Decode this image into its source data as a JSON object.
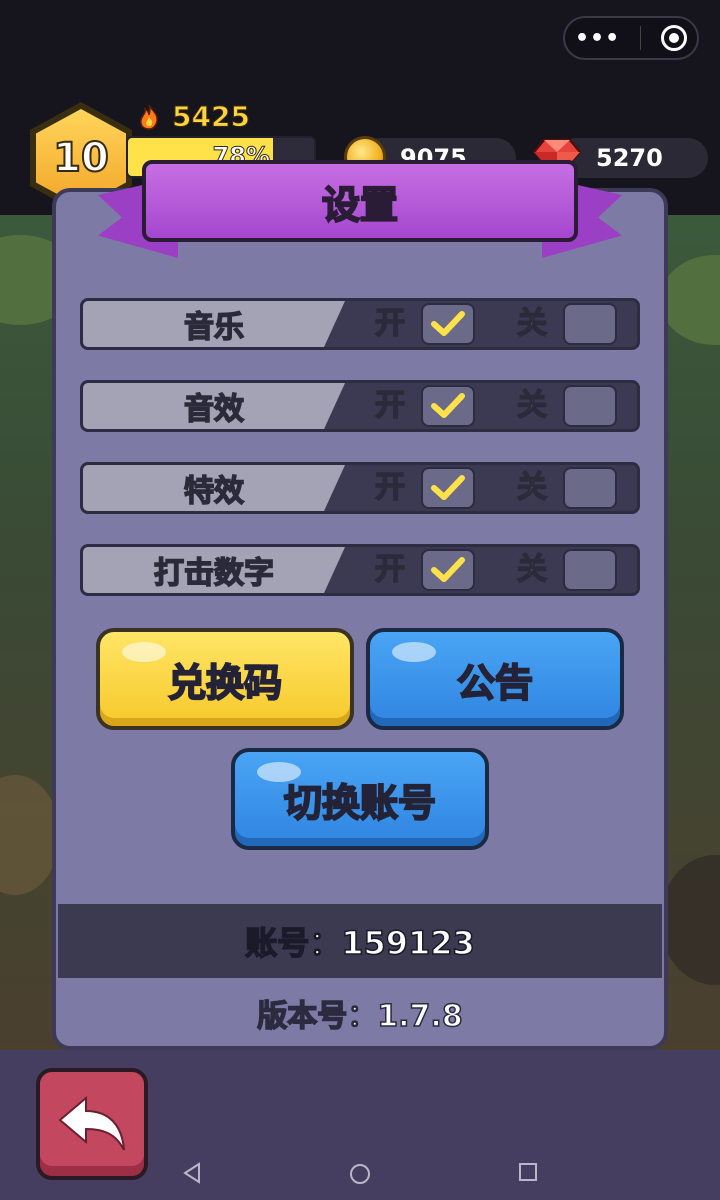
{
  "hud": {
    "level": "10",
    "fire_value": "5425",
    "xp_percent_text": "78%",
    "xp_progress": 0.78,
    "coins": "9075",
    "gems": "5270"
  },
  "dialog": {
    "title": "设置",
    "on_label": "开",
    "off_label": "关",
    "settings": [
      {
        "label": "音乐",
        "on": true
      },
      {
        "label": "音效",
        "on": true
      },
      {
        "label": "特效",
        "on": true
      },
      {
        "label": "打击数字",
        "on": true
      }
    ],
    "buttons": {
      "redeem": "兑换码",
      "notice": "公告",
      "switch_account": "切换账号"
    },
    "account_text": "账号：159123",
    "version_text": "版本号：1.7.8"
  },
  "icons": {
    "menu": "more-dots-icon",
    "close": "target-circle-icon",
    "back": "back-arrow-icon",
    "fire": "fire-icon",
    "coin": "coin-icon",
    "gem": "gem-icon"
  },
  "colors": {
    "panel": "#7d7aa6",
    "ribbon": "#b357d8",
    "yellow_button": "#f7c92a",
    "blue_button": "#2f84e0",
    "back_button": "#c2475f",
    "xp_fill": "#ffe14a"
  }
}
